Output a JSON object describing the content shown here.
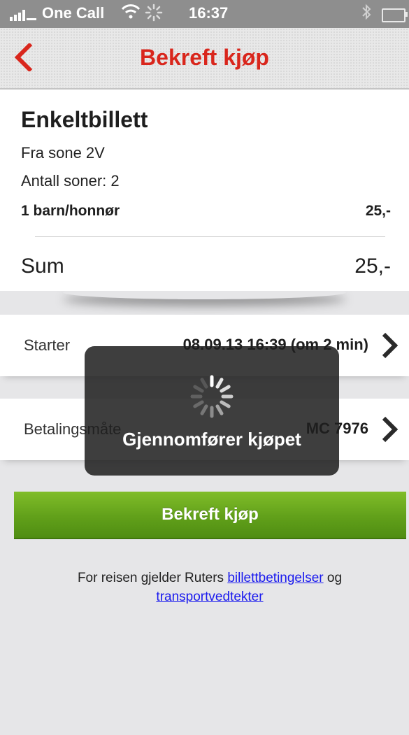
{
  "status_bar": {
    "carrier": "One Call",
    "time": "16:37",
    "icons": [
      "signal-icon",
      "wifi-icon",
      "activity-icon",
      "bluetooth-icon",
      "battery-icon"
    ]
  },
  "nav": {
    "title": "Bekreft kjøp",
    "back_icon": "chevron-left-icon",
    "accent_color": "#d9261c"
  },
  "ticket": {
    "title": "Enkeltbillett",
    "zone_from": "Fra sone 2V",
    "zone_count": "Antall soner: 2",
    "passenger_type": "1 barn/honnør",
    "passenger_price": "25,-",
    "sum_label": "Sum",
    "sum_value": "25,-"
  },
  "start_row": {
    "label": "Starter",
    "value": "08.09.13 16:39 (om 2 min)"
  },
  "payment_row": {
    "label": "Betalingsmåte",
    "value": "MC 7976"
  },
  "confirm_button": {
    "label": "Bekreft kjøp",
    "color": "#61a01a"
  },
  "terms": {
    "prefix": "For reisen gjelder Ruters ",
    "link1": "billettbetingelser",
    "middle": " og",
    "link2": "transportvedtekter"
  },
  "overlay": {
    "text": "Gjennomfører kjøpet",
    "spinner_icon": "spinner-icon"
  }
}
